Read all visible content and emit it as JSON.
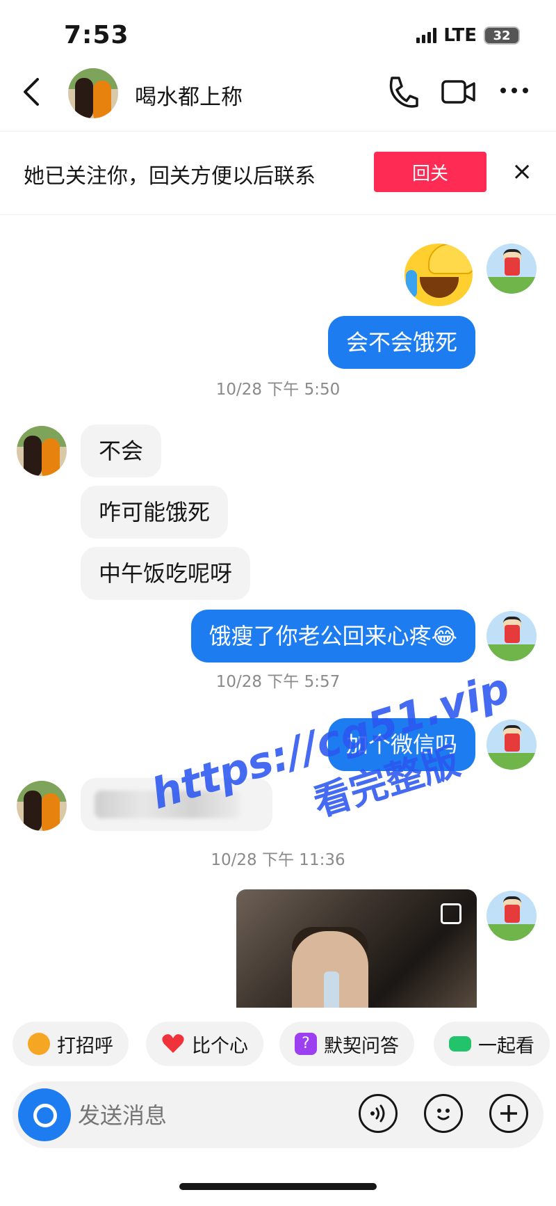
{
  "status_bar": {
    "time": "7:53",
    "network": "LTE",
    "battery": "32"
  },
  "header": {
    "contact_name": "喝水都上称"
  },
  "follow_banner": {
    "text": "她已关注你，回关方便以后联系",
    "button_label": "回关",
    "close_label": "×"
  },
  "messages": [
    {
      "from": "me",
      "text": "会不会饿死"
    },
    {
      "from": "them",
      "text": "不会"
    },
    {
      "from": "them",
      "text": "咋可能饿死"
    },
    {
      "from": "them",
      "text": "中午饭吃呢呀"
    },
    {
      "from": "me",
      "text": "饿瘦了你老公回来心疼😂"
    },
    {
      "from": "me",
      "text": "加个微信吗"
    }
  ],
  "timestamps": [
    "10/28 下午 5:50",
    "10/28 下午 5:57",
    "10/28 下午 11:36"
  ],
  "watermark": {
    "line1": "https://cg51.vip",
    "line2": "看完整版"
  },
  "quick_actions": [
    {
      "label": "打招呼",
      "icon": "wave-hand-icon",
      "color": "#f5a623"
    },
    {
      "label": "比个心",
      "icon": "heart-icon",
      "color": "#f0333b"
    },
    {
      "label": "默契问答",
      "icon": "question-icon",
      "color": "#9b3ff0"
    },
    {
      "label": "一起看",
      "icon": "sofa-icon",
      "color": "#22c36a"
    }
  ],
  "input": {
    "placeholder": "发送消息"
  }
}
